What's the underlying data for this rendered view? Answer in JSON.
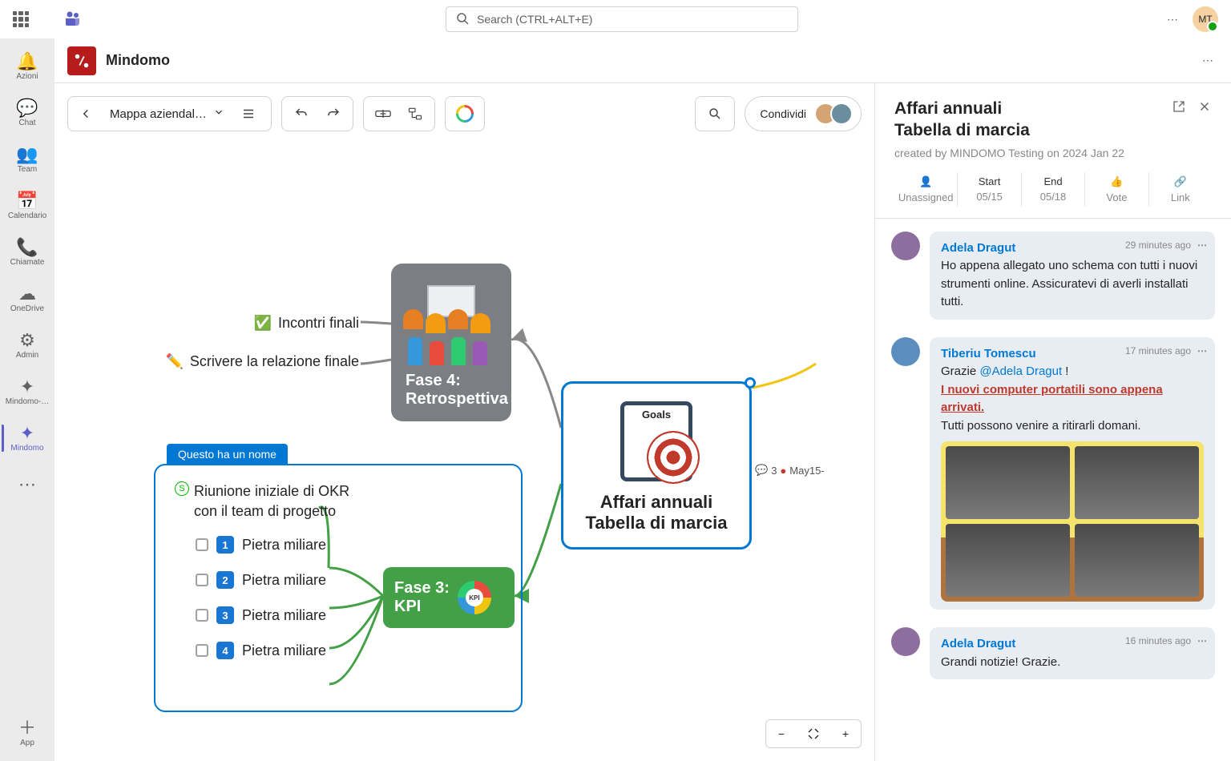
{
  "topbar": {
    "search_placeholder": "Search (CTRL+ALT+E)",
    "avatar": "MT"
  },
  "rail": [
    {
      "icon": "🔔",
      "label": "Azioni"
    },
    {
      "icon": "💬",
      "label": "Chat"
    },
    {
      "icon": "👥",
      "label": "Team"
    },
    {
      "icon": "📅",
      "label": "Calendario"
    },
    {
      "icon": "📞",
      "label": "Chiamate"
    },
    {
      "icon": "☁",
      "label": "OneDrive"
    },
    {
      "icon": "⚙",
      "label": "Admin"
    },
    {
      "icon": "✦",
      "label": "Mindomo-…"
    },
    {
      "icon": "✦",
      "label": "Mindomo",
      "active": true
    },
    {
      "icon": "⋯",
      "label": ""
    },
    {
      "icon": "＋",
      "label": "App",
      "bottom": true
    }
  ],
  "tab": {
    "app_name": "Mindomo"
  },
  "toolbar": {
    "doc_name": "Mappa aziendal…",
    "share": "Condividi"
  },
  "mind": {
    "main_title1": "Affari annuali",
    "main_title2": "Tabella di marcia",
    "goals": "Goals",
    "meta_count": "3",
    "meta_date": "May15-",
    "phase4_l1": "Fase 4:",
    "phase4_l2": "Retrospettiva",
    "sub_finals": "Incontri finali",
    "sub_report": "Scrivere la relazione finale",
    "label_tab": "Questo ha un nome",
    "bluebox_title": "Riunione iniziale di OKR con il team di progetto",
    "ms1": "Pietra miliare",
    "ms2": "Pietra miliare",
    "ms3": "Pietra miliare",
    "ms4": "Pietra miliare",
    "phase3_l1": "Fase 3:",
    "phase3_l2": "KPI"
  },
  "panel": {
    "title1": "Affari annuali",
    "title2": "Tabella di marcia",
    "created": "created by MINDOMO Testing on 2024 Jan 22",
    "meta": [
      {
        "top": "👤",
        "lbl": "Unassigned"
      },
      {
        "top": "Start",
        "lbl": "05/15"
      },
      {
        "top": "End",
        "lbl": "05/18"
      },
      {
        "top": "👍",
        "lbl": "Vote"
      },
      {
        "top": "🔗",
        "lbl": "Link"
      }
    ],
    "comments": [
      {
        "author": "Adela Dragut",
        "time": "29 minutes ago",
        "body": "Ho appena allegato uno schema con tutti i nuovi strumenti online. Assicuratevi di averli installati tutti."
      },
      {
        "author": "Tiberiu Tomescu",
        "time": "17 minutes ago",
        "pre": "Grazie ",
        "mention": "@Adela Dragut",
        "post": " !",
        "highlight": "I nuovi computer portatili sono appena arrivati.",
        "body2": "Tutti possono venire a ritirarli domani.",
        "img": true
      },
      {
        "author": "Adela Dragut",
        "time": "16 minutes ago",
        "body": "Grandi notizie! Grazie."
      }
    ]
  }
}
